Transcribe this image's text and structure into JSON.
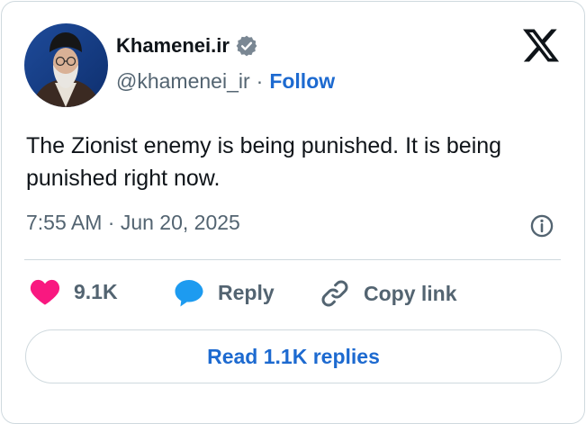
{
  "author": {
    "name": "Khamenei.ir",
    "handle": "@khamenei_ir",
    "separator": "·",
    "follow_label": "Follow",
    "verified_icon": "verified-badge-icon"
  },
  "brand": {
    "logo_icon": "x-logo-icon"
  },
  "tweet": {
    "text": "The Zionist enemy is being punished. It is being punished right now.",
    "timestamp": "7:55 AM · Jun 20, 2025"
  },
  "actions": {
    "like_count": "9.1K",
    "reply_label": "Reply",
    "copy_label": "Copy link"
  },
  "read_replies_label": "Read 1.1K replies",
  "colors": {
    "accent": "#1d6ad0",
    "like": "#f91880",
    "reply_bubble": "#1d9bf0",
    "muted": "#536471",
    "border": "#cfd9de"
  }
}
